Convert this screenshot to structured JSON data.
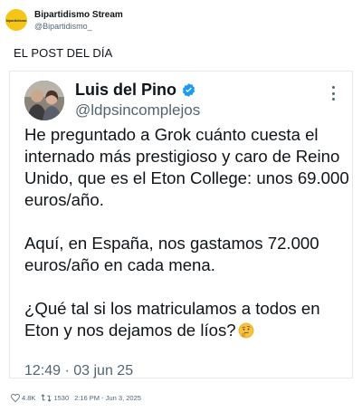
{
  "header": {
    "avatar_text": "bipartidismo",
    "name": "Bipartidismo Stream",
    "handle": "@Bipartidismo_"
  },
  "post_title": "EL POST DEL DÍA",
  "tweet": {
    "author_name": "Luis del Pino",
    "author_handle": "@ldpsincomplejos",
    "paragraphs": [
      "He preguntado a Grok cuánto cuesta el internado más prestigioso y caro de Reino Unido, que es el Eton College: unos 69.000 euros/año.",
      "Aquí,  en España, nos gastamos 72.000 euros/año en cada mena.",
      "¿Qué tal si los matriculamos a todos en Eton y nos dejamos de líos?"
    ],
    "timestamp": "12:49 · 03 jun 25"
  },
  "footer": {
    "likes": "4.8K",
    "retweets": "1530",
    "datetime": "2:16 PM - Jun 3, 2025"
  },
  "colors": {
    "verified": "#1d9bf0",
    "muted": "#536471",
    "text": "#0f1419"
  }
}
